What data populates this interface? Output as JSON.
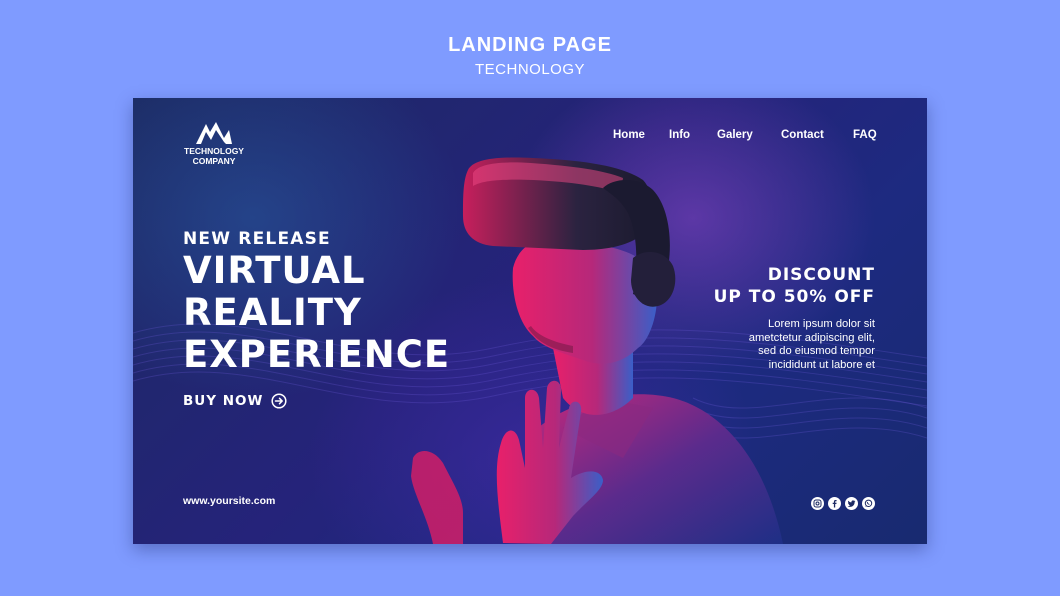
{
  "header": {
    "title": "LANDING PAGE",
    "subtitle": "TECHNOLOGY"
  },
  "logo": {
    "line1": "TECHNOLOGY",
    "line2": "COMPANY",
    "icon": "wave-logo-icon"
  },
  "nav": {
    "items": [
      "Home",
      "Info",
      "Galery",
      "Contact",
      "FAQ"
    ]
  },
  "hero": {
    "kicker": "NEW RELEASE",
    "headline": [
      "VIRTUAL",
      "REALITY",
      "EXPERIENCE"
    ],
    "cta_label": "BUY NOW",
    "cta_icon": "arrow-circle-right-icon"
  },
  "promo": {
    "title_lines": [
      "DISCOUNT",
      "UP TO 50% OFF"
    ],
    "body_lines": [
      "Lorem ipsum dolor sit",
      "ametctetur adipiscing elit,",
      "sed do eiusmod tempor",
      "incididunt ut labore et"
    ]
  },
  "footer": {
    "site": "www.yoursite.com",
    "social_icons": [
      "instagram-icon",
      "facebook-icon",
      "twitter-icon",
      "whatsapp-icon"
    ]
  },
  "colors": {
    "page_background": "#7f9bff",
    "card_dark": "#1c2a63",
    "accent_pink": "#e8206a",
    "accent_blue": "#3a7bd5"
  }
}
